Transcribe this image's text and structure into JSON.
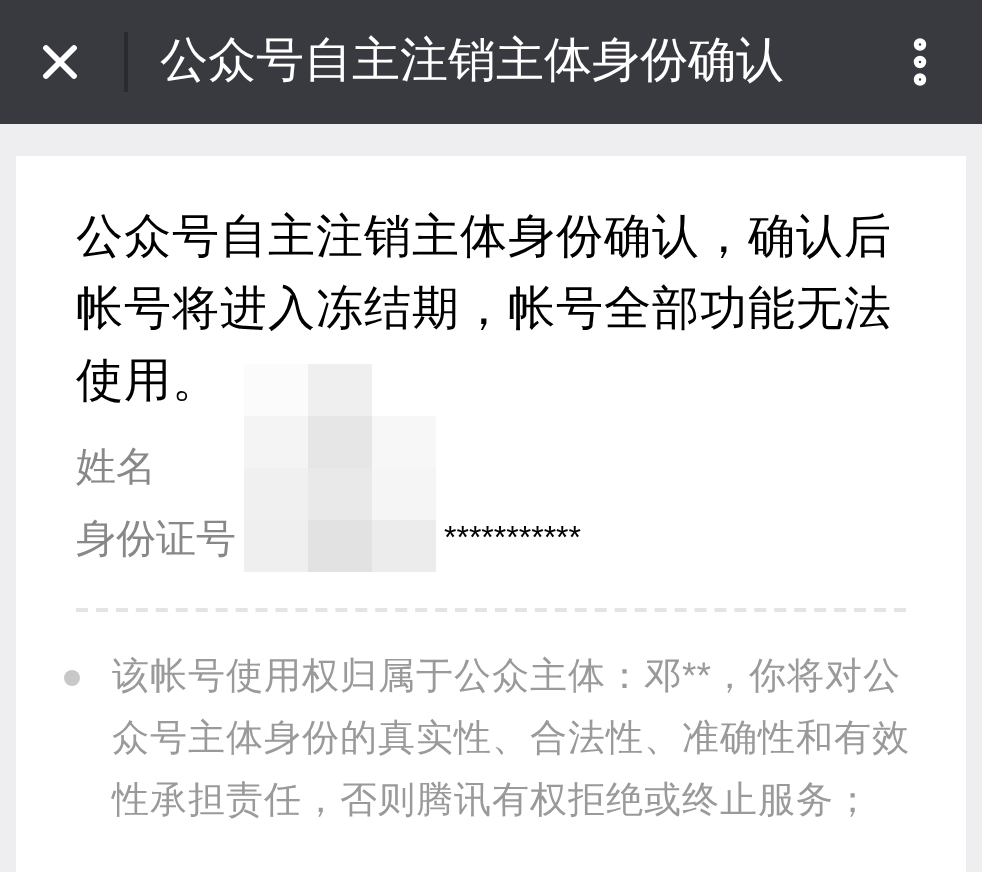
{
  "header": {
    "title": "公众号自主注销主体身份确认"
  },
  "notice": "公众号自主注销主体身份确认，确认后帐号将进入冻结期，帐号全部功能无法使用。",
  "fields": [
    {
      "label": "姓名"
    },
    {
      "label": "身份证号",
      "value": "***********"
    }
  ],
  "bullets": [
    "该帐号使用权归属于公众主体：邓**，你将对公众号主体身份的真实性、合法性、准确性和有效性承担责任，否则腾讯有权拒绝或终止服务；"
  ]
}
